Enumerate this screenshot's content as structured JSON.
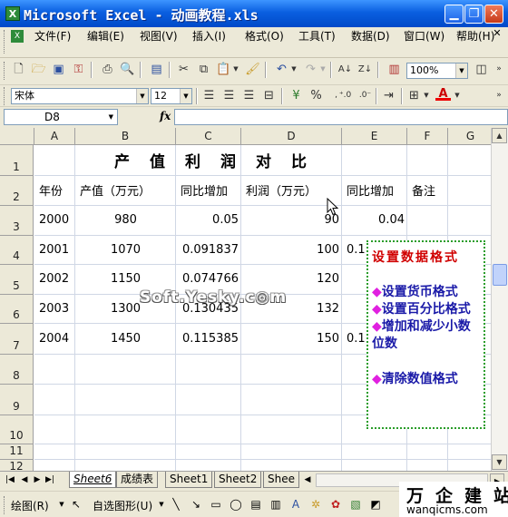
{
  "window": {
    "title": "Microsoft Excel - 动画教程.xls",
    "app_icon": "X"
  },
  "menu": [
    "文件(F)",
    "编辑(E)",
    "视图(V)",
    "插入(I)",
    "格式(O)",
    "工具(T)",
    "数据(D)",
    "窗口(W)",
    "帮助(H)"
  ],
  "toolbar": {
    "zoom": "100%",
    "font": "宋体",
    "font_size": "12"
  },
  "formula_bar": {
    "name_box": "D8",
    "fx": "fx"
  },
  "columns": [
    "A",
    "B",
    "C",
    "D",
    "E",
    "F",
    "G"
  ],
  "rows": [
    "1",
    "2",
    "3",
    "4",
    "5",
    "6",
    "7",
    "8",
    "9",
    "10",
    "11",
    "12"
  ],
  "sheet": {
    "title": "产值利润对比",
    "headers": [
      "年份",
      "产值（万元）",
      "同比增加",
      "利润（万元）",
      "同比增加",
      "备注"
    ],
    "data": [
      [
        "2000",
        "980",
        "0.05",
        "90",
        "0.04"
      ],
      [
        "2001",
        "1070",
        "0.091837",
        "100",
        "0.1"
      ],
      [
        "2002",
        "1150",
        "0.074766",
        "120",
        ""
      ],
      [
        "2003",
        "1300",
        "0.130435",
        "132",
        ""
      ],
      [
        "2004",
        "1450",
        "0.115385",
        "150",
        "0.1"
      ]
    ]
  },
  "tabs": [
    "Sheet6",
    "成绩表",
    "Sheet1",
    "Sheet2",
    "Shee"
  ],
  "drawing_toolbar": {
    "draw": "绘图(R)",
    "autoshapes": "自选图形(U)"
  },
  "tip": {
    "title": "设置数据格式",
    "items": [
      "设置货币格式",
      "设置百分比格式",
      "增加和减少小数位数",
      "清除数值格式"
    ],
    "bullet": "◆"
  },
  "watermark": "Soft.Yesky.c◎m",
  "brand": {
    "cn": "万企建站",
    "en": "wanqicms.com"
  },
  "colors": {
    "titlebar": "#0a5fe0",
    "tip_title": "#d00000",
    "tip_text": "#1a1aa8",
    "tip_bullet": "#e020e0",
    "tip_border": "#2a9d2a"
  }
}
